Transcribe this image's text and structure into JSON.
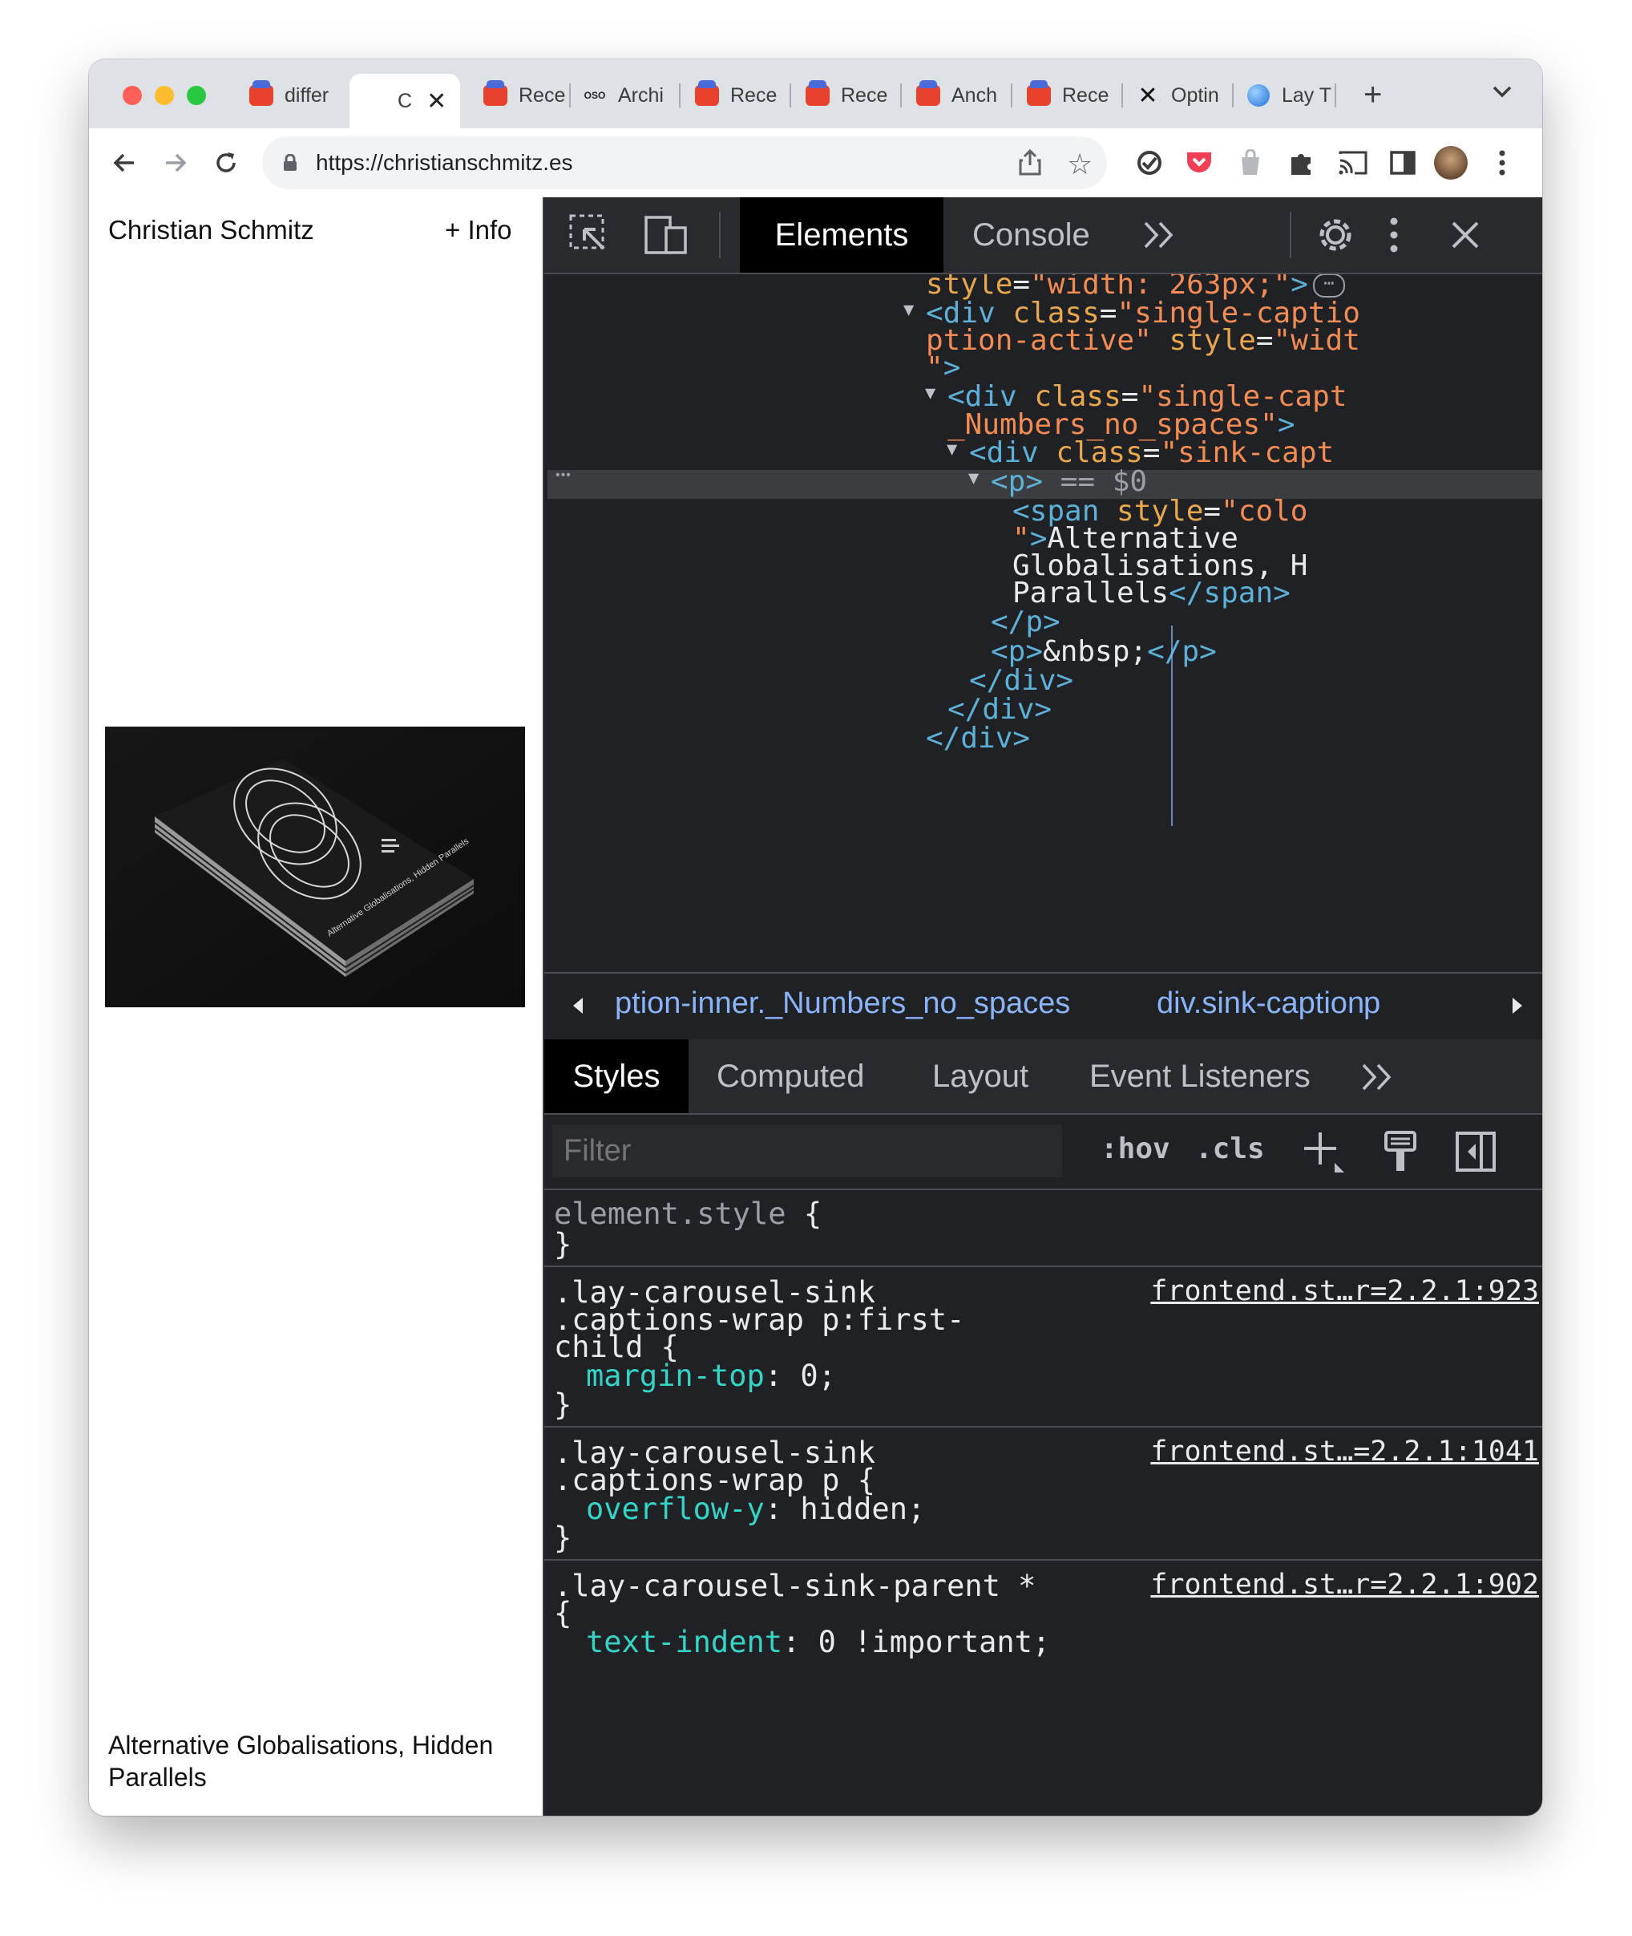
{
  "browser": {
    "tabs": [
      {
        "label": "differ",
        "favicon": "red-favicon"
      },
      {
        "label": "C",
        "favicon": "none",
        "active": true
      },
      {
        "label": "Rece",
        "favicon": "red-favicon"
      },
      {
        "label": "Archi",
        "favicon": "oso-favicon",
        "favicon_text": "OSO"
      },
      {
        "label": "Rece",
        "favicon": "red-favicon"
      },
      {
        "label": "Rece",
        "favicon": "red-favicon"
      },
      {
        "label": "Anch",
        "favicon": "red-favicon"
      },
      {
        "label": "Rece",
        "favicon": "red-favicon"
      },
      {
        "label": "Optin",
        "favicon": "cross-favicon"
      },
      {
        "label": "Lay T",
        "favicon": "globe-favicon"
      }
    ],
    "url": "https://christianschmitz.es"
  },
  "page": {
    "site_title": "Christian Schmitz",
    "info_link": "+ Info",
    "caption": "Alternative Globalisations, Hidden Parallels",
    "image_title_small": "Alternative Globalisations, Hidden Parallels"
  },
  "devtools": {
    "tabs": [
      "Elements",
      "Console"
    ],
    "active_tab": "Elements",
    "dom_lines": [
      {
        "indent": 0,
        "arrow": false,
        "parts": [
          [
            "an",
            "style"
          ],
          [
            "c1",
            "="
          ],
          [
            "av",
            "\"width: 263px;\""
          ],
          [
            "t",
            ">"
          ]
        ],
        "ellipsis": true
      },
      {
        "indent": 0,
        "arrow": true,
        "parts": [
          [
            "t",
            "<div "
          ],
          [
            "an",
            "class"
          ],
          [
            "c1",
            "="
          ],
          [
            "av",
            "\"single-captio"
          ]
        ]
      },
      {
        "indent": 0,
        "arrow": false,
        "parts": [
          [
            "av",
            "ption-active\""
          ],
          [
            "c1",
            " "
          ],
          [
            "an",
            "style"
          ],
          [
            "c1",
            "="
          ],
          [
            "av",
            "\"widt"
          ]
        ]
      },
      {
        "indent": 0,
        "arrow": false,
        "parts": [
          [
            "av",
            "\""
          ],
          [
            "t",
            ">"
          ]
        ]
      },
      {
        "indent": 1,
        "arrow": true,
        "parts": [
          [
            "t",
            "<div "
          ],
          [
            "an",
            "class"
          ],
          [
            "c1",
            "="
          ],
          [
            "av",
            "\"single-capt"
          ]
        ]
      },
      {
        "indent": 1,
        "arrow": false,
        "parts": [
          [
            "av",
            "_Numbers_no_spaces\""
          ],
          [
            "t",
            ">"
          ]
        ]
      },
      {
        "indent": 2,
        "arrow": true,
        "parts": [
          [
            "t",
            "<div "
          ],
          [
            "an",
            "class"
          ],
          [
            "c1",
            "="
          ],
          [
            "av",
            "\"sink-capt"
          ]
        ]
      },
      {
        "indent": 3,
        "arrow": true,
        "selected": true,
        "parts": [
          [
            "t",
            "<p>"
          ],
          [
            "dim",
            " == "
          ],
          [
            "dim",
            "$0"
          ]
        ]
      },
      {
        "indent": 4,
        "arrow": false,
        "parts": [
          [
            "t",
            "<span "
          ],
          [
            "an",
            "style"
          ],
          [
            "c1",
            "="
          ],
          [
            "av",
            "\"colo"
          ]
        ]
      },
      {
        "indent": 4,
        "arrow": false,
        "parts": [
          [
            "av",
            "\""
          ],
          [
            "t",
            ">"
          ],
          [
            "c1",
            "Alternative"
          ]
        ]
      },
      {
        "indent": 4,
        "arrow": false,
        "parts": [
          [
            "c1",
            "Globalisations, H"
          ]
        ]
      },
      {
        "indent": 4,
        "arrow": false,
        "parts": [
          [
            "c1",
            "Parallels"
          ],
          [
            "t",
            "</span>"
          ]
        ]
      },
      {
        "indent": 3,
        "arrow": false,
        "parts": [
          [
            "t",
            "</p>"
          ]
        ]
      },
      {
        "indent": 3,
        "arrow": false,
        "parts": [
          [
            "t",
            "<p>"
          ],
          [
            "c1",
            "&nbsp;"
          ],
          [
            "t",
            "</p>"
          ]
        ]
      },
      {
        "indent": 2,
        "arrow": false,
        "parts": [
          [
            "t",
            "</div>"
          ]
        ]
      },
      {
        "indent": 1,
        "arrow": false,
        "parts": [
          [
            "t",
            "</div>"
          ]
        ]
      },
      {
        "indent": 0,
        "arrow": false,
        "parts": [
          [
            "t",
            "</div>"
          ]
        ]
      }
    ],
    "breadcrumbs": [
      "ption-inner._Numbers_no_spaces",
      "div.sink-caption",
      "p"
    ],
    "styles_tabs": [
      "Styles",
      "Computed",
      "Layout",
      "Event Listeners"
    ],
    "filter_placeholder": "Filter",
    "hov_label": ":hov",
    "cls_label": ".cls",
    "rules": [
      {
        "selector_lines": [
          "element.style {"
        ],
        "selector_dim": true,
        "source": "",
        "decls": [],
        "close": "}"
      },
      {
        "selector_lines": [
          ".lay-carousel-sink",
          ".captions-wrap p:first-",
          "child {"
        ],
        "source": "frontend.st…r=2.2.1:923",
        "decls": [
          {
            "prop": "margin-top",
            "value": "0;"
          }
        ],
        "close": "}"
      },
      {
        "selector_lines": [
          ".lay-carousel-sink",
          ".captions-wrap p {"
        ],
        "source": "frontend.st…=2.2.1:1041",
        "decls": [
          {
            "prop": "overflow-y",
            "value": "hidden;"
          }
        ],
        "close": "}"
      },
      {
        "selector_lines": [
          ".lay-carousel-sink-parent *",
          "{"
        ],
        "source": "frontend.st…r=2.2.1:902",
        "decls": [
          {
            "prop": "text-indent",
            "value": "0 !important;"
          }
        ],
        "close": ""
      }
    ]
  },
  "colors": {
    "traffic_red": "#fe5f57",
    "traffic_yellow": "#febc2e",
    "traffic_green": "#28c840",
    "devtools_bg": "#202124",
    "tag_blue": "#5db0d7",
    "attr_value_orange": "#f28b54",
    "css_prop_teal": "#35d4c7"
  }
}
